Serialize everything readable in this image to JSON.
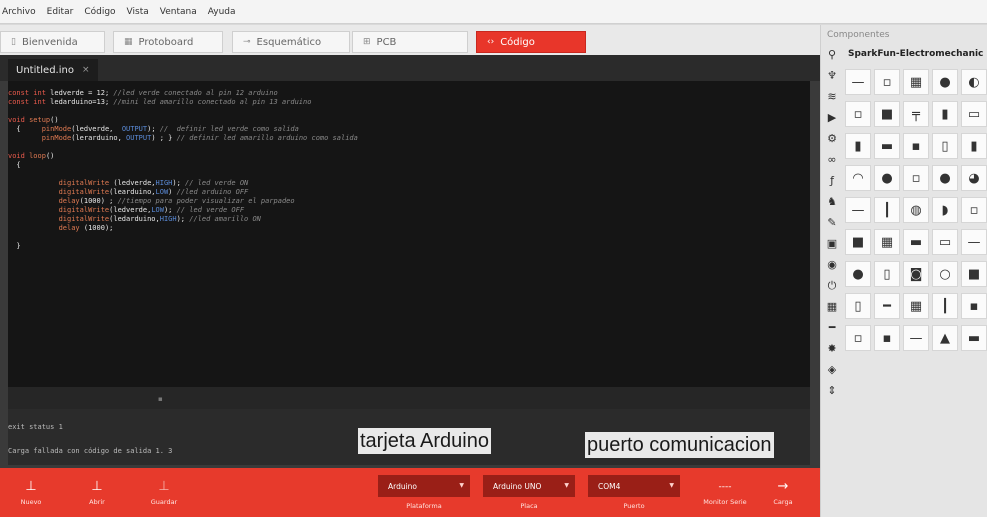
{
  "menu": [
    "Archivo",
    "Editar",
    "Código",
    "Vista",
    "Ventana",
    "Ayuda"
  ],
  "view_tabs": [
    {
      "label": "Bienvenida",
      "icon": "document-icon",
      "active": false
    },
    {
      "label": "Protoboard",
      "icon": "breadboard-icon",
      "active": false
    },
    {
      "label": "Esquemático",
      "icon": "schematic-icon",
      "active": false
    },
    {
      "label": "PCB",
      "icon": "pcb-icon",
      "active": false
    },
    {
      "label": "Código",
      "icon": "code-icon",
      "active": true
    }
  ],
  "file_tab": {
    "name": "Untitled.ino",
    "close": "×"
  },
  "code_lines": [
    [
      [
        "kw",
        "const int "
      ],
      [
        "tx",
        "ledverde = 12; "
      ],
      [
        "cm",
        "//led verde conectado al pin 12 arduino"
      ]
    ],
    [
      [
        "kw",
        "const int "
      ],
      [
        "tx",
        "ledarduino=13; "
      ],
      [
        "cm",
        "//mini led amarillo conectado al pin 13 arduino"
      ]
    ],
    [],
    [
      [
        "kw",
        "void "
      ],
      [
        "fn",
        "setup"
      ],
      [
        "tx",
        "()"
      ]
    ],
    [
      [
        "tx",
        "  {     "
      ],
      [
        "fn",
        "pinMode"
      ],
      [
        "tx",
        "(ledverde,  "
      ],
      [
        "cn",
        "OUTPUT"
      ],
      [
        "tx",
        "); "
      ],
      [
        "cm",
        "//  definir led verde como salida"
      ]
    ],
    [
      [
        "tx",
        "        "
      ],
      [
        "fn",
        "pinMode"
      ],
      [
        "tx",
        "(lerarduino, "
      ],
      [
        "cn",
        "OUTPUT"
      ],
      [
        "tx",
        ") ; } "
      ],
      [
        "cm",
        "// definir led amarillo arduino como salida"
      ]
    ],
    [],
    [
      [
        "kw",
        "void "
      ],
      [
        "fn",
        "loop"
      ],
      [
        "tx",
        "()"
      ]
    ],
    [
      [
        "tx",
        "  {"
      ]
    ],
    [],
    [
      [
        "tx",
        "            "
      ],
      [
        "fn",
        "digitalWrite"
      ],
      [
        "tx",
        " (ledverde,"
      ],
      [
        "cn",
        "HIGH"
      ],
      [
        "tx",
        "); "
      ],
      [
        "cm",
        "// led verde ON"
      ]
    ],
    [
      [
        "tx",
        "            "
      ],
      [
        "fn",
        "digitalWrite"
      ],
      [
        "tx",
        "(learduino,"
      ],
      [
        "cn",
        "LOW"
      ],
      [
        "tx",
        ") "
      ],
      [
        "cm",
        "//led arduino OFF"
      ]
    ],
    [
      [
        "tx",
        "            "
      ],
      [
        "fn",
        "delay"
      ],
      [
        "tx",
        "(1000) ; "
      ],
      [
        "cm",
        "//tiempo para poder visualizar el parpadeo"
      ]
    ],
    [
      [
        "tx",
        "            "
      ],
      [
        "fn",
        "digitalWrite"
      ],
      [
        "tx",
        "(ledverde,"
      ],
      [
        "cn",
        "LOW"
      ],
      [
        "tx",
        "); "
      ],
      [
        "cm",
        "// led verde OFF"
      ]
    ],
    [
      [
        "tx",
        "            "
      ],
      [
        "fn",
        "digitalWrite"
      ],
      [
        "tx",
        "(ledarduino,"
      ],
      [
        "cn",
        "HIGH"
      ],
      [
        "tx",
        "); "
      ],
      [
        "cm",
        "//led amarillo ON"
      ]
    ],
    [
      [
        "tx",
        "            "
      ],
      [
        "fn",
        "delay"
      ],
      [
        "tx",
        " (1000);"
      ]
    ],
    [],
    [
      [
        "tx",
        "  }"
      ]
    ]
  ],
  "console": {
    "line1": "exit status 1",
    "line2": "Carga fallada con código de salida 1. 3"
  },
  "annotations": {
    "board": "tarjeta Arduino",
    "port": "puerto comunicacion"
  },
  "toolbar": {
    "new": "Nuevo",
    "open": "Abrir",
    "save": "Guardar",
    "platform_value": "Arduino",
    "platform_label": "Plataforma",
    "board_value": "Arduino UNO",
    "board_label": "Placa",
    "port_value": "COM4",
    "port_label": "Puerto",
    "monitor_glyph": "----",
    "monitor_label": "Monitor Serie",
    "upload_label": "Carga"
  },
  "panel": {
    "title": "Componentes",
    "package": "SparkFun-Electromechanic",
    "categories": [
      "pin-icon",
      "core-icon",
      "wire-icon",
      "play-icon",
      "gear-icon",
      "arduino-icon",
      "fx-icon",
      "robot-icon",
      "contrib-icon",
      "chip-icon",
      "sensor-icon",
      "power-icon",
      "ic-icon",
      "cable-icon",
      "star-icon",
      "misc-icon",
      "up-down-icon"
    ],
    "parts": [
      "—",
      "▫",
      "▦",
      "●",
      "◐",
      "▫",
      "■",
      "╤",
      "▮",
      "▭",
      "▮",
      "▬",
      "▪",
      "▯",
      "▮",
      "◠",
      "●",
      "▫",
      "●",
      "◕",
      "—",
      "┃",
      "◍",
      "◗",
      "▫",
      "■",
      "▦",
      "▬",
      "▭",
      "—",
      "●",
      "▯",
      "◙",
      "○",
      "■",
      "▯",
      "━",
      "▦",
      "┃",
      "▪",
      "▫",
      "▪",
      "—",
      "▲",
      "▬"
    ]
  }
}
